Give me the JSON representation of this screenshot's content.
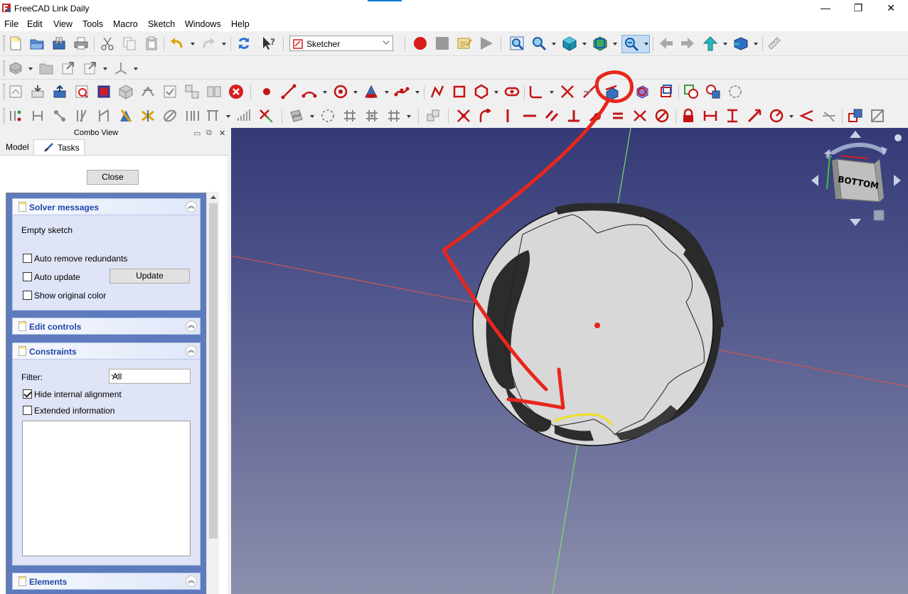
{
  "window": {
    "title": "FreeCAD Link Daily",
    "minimize": "—",
    "maximize": "❐",
    "close": "✕"
  },
  "menu": [
    "File",
    "Edit",
    "View",
    "Tools",
    "Macro",
    "Sketch",
    "Windows",
    "Help"
  ],
  "toolbar": {
    "workbench": "Sketcher"
  },
  "combo_view": {
    "title": "Combo View",
    "tabs": [
      "Model",
      "Tasks"
    ],
    "active_tab": "Tasks",
    "close_label": "Close"
  },
  "panels": {
    "solver": {
      "title": "Solver messages",
      "message": "Empty sketch",
      "auto_remove": "Auto remove redundants",
      "auto_remove_checked": false,
      "auto_update": "Auto update",
      "auto_update_checked": false,
      "update_label": "Update",
      "show_original": "Show original color",
      "show_original_checked": false
    },
    "edit_controls": {
      "title": "Edit controls"
    },
    "constraints": {
      "title": "Constraints",
      "filter_label": "Filter:",
      "filter_value": "All",
      "hide_internal": "Hide internal alignment",
      "hide_internal_checked": true,
      "extended_info": "Extended information",
      "extended_info_checked": false
    },
    "elements": {
      "title": "Elements"
    }
  },
  "navcube": {
    "face": "BOTTOM"
  },
  "colors": {
    "annotation": "#e8261c",
    "x_axis": "#e0554a",
    "y_axis": "#7cdc6c",
    "highlight_edge": "#f0e020",
    "origin": "#e82010"
  }
}
